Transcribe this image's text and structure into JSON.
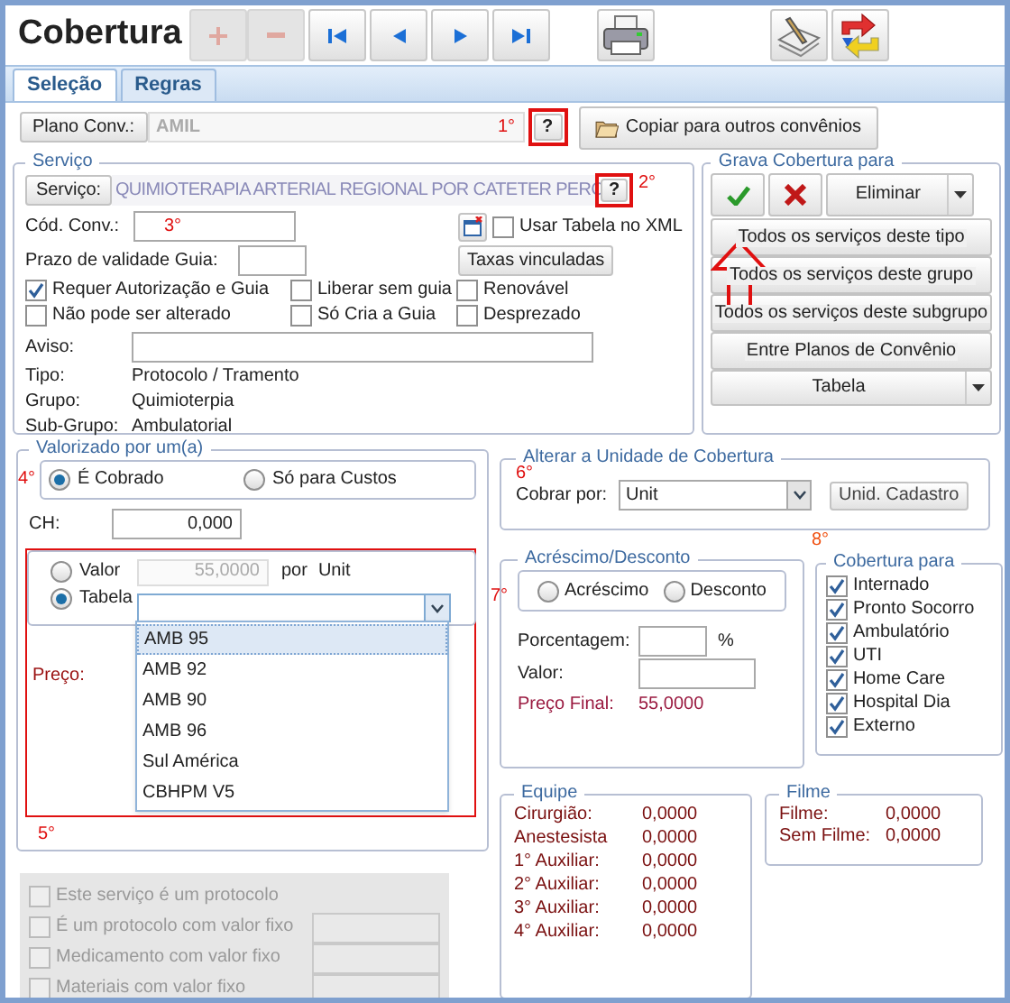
{
  "window": {
    "title": "Cobertura"
  },
  "toolbar": [
    {
      "kind": "add",
      "disabled": true
    },
    {
      "kind": "remove",
      "disabled": true
    },
    {
      "kind": "first",
      "disabled": false
    },
    {
      "kind": "previous",
      "disabled": false
    },
    {
      "kind": "next",
      "disabled": false
    },
    {
      "kind": "last",
      "disabled": false
    },
    {
      "kind": "print",
      "disabled": false
    },
    {
      "kind": "edit",
      "disabled": false
    },
    {
      "kind": "sync",
      "disabled": false
    }
  ],
  "tabs": [
    {
      "label": "Seleção",
      "selected": true
    },
    {
      "label": "Regras",
      "selected": false
    }
  ],
  "plano": {
    "button": "Plano Conv.:",
    "value": "AMIL",
    "annotation": "1°",
    "help": "?",
    "copy_button": "Copiar para outros convênios"
  },
  "servico": {
    "legend": "Serviço",
    "button": "Serviço:",
    "value": "QUIMIOTERAPIA ARTERIAL REGIONAL POR CATETER PERC",
    "help": "?",
    "annotation": "2°",
    "cod_label": "Cód. Conv.:",
    "cod_annotation": "3°",
    "prazo_label": "Prazo de validade Guia:",
    "xml_checkbox": {
      "label": "Usar Tabela no XML",
      "checked": false
    },
    "taxas_button": "Taxas vinculadas",
    "checkboxes": [
      {
        "label": "Requer Autorização e Guia",
        "checked": true
      },
      {
        "label": "Liberar sem guia",
        "checked": false
      },
      {
        "label": "Renovável",
        "checked": false
      },
      {
        "label": "Não pode ser alterado",
        "checked": false
      },
      {
        "label": "Só Cria a Guia",
        "checked": false
      },
      {
        "label": "Desprezado",
        "checked": false
      }
    ],
    "aviso_label": "Aviso:",
    "info": [
      {
        "label": "Tipo:",
        "value": "Protocolo / Tramento"
      },
      {
        "label": "Grupo:",
        "value": "Quimioterpia"
      },
      {
        "label": "Sub-Grupo:",
        "value": "Ambulatorial"
      }
    ]
  },
  "grava": {
    "legend": "Grava Cobertura para",
    "eliminar": "Eliminar",
    "buttons": [
      "Todos os serviços deste tipo",
      "Todos os serviços deste grupo",
      "Todos os serviços deste subgrupo",
      "Entre Planos de Convênio"
    ],
    "tabela": "Tabela"
  },
  "valorizado": {
    "legend": "Valorizado por um(a)",
    "annotation": "4°",
    "radios": [
      {
        "label": "É Cobrado",
        "selected": true
      },
      {
        "label": "Só para Custos",
        "selected": false
      }
    ],
    "ch_label": "CH:",
    "ch_value": "0,000",
    "price_radios": [
      {
        "label": "Valor",
        "selected": false
      },
      {
        "label": "Tabela",
        "selected": true
      }
    ],
    "valor_value": "55,0000",
    "por": "por",
    "unit": "Unit",
    "tabela_select": {
      "expanded": true,
      "options": [
        {
          "label": "AMB 95",
          "selected": true
        },
        {
          "label": "AMB 92",
          "selected": false
        },
        {
          "label": "AMB 90",
          "selected": false
        },
        {
          "label": "AMB 96",
          "selected": false
        },
        {
          "label": "Sul América",
          "selected": false
        },
        {
          "label": "CBHPM V5",
          "selected": false
        }
      ]
    },
    "preco_label": "Preço:",
    "bottom_annotation": "5°"
  },
  "protocolo": [
    {
      "label": "Este serviço é um protocolo",
      "checked": false,
      "kind": "plain"
    },
    {
      "label": "É um protocolo com valor fixo",
      "checked": false,
      "kind": "with_field"
    },
    {
      "label": "Medicamento com valor fixo",
      "checked": false,
      "kind": "with_field"
    },
    {
      "label": "Materiais com valor fixo",
      "checked": false,
      "kind": "with_field"
    }
  ],
  "alterar": {
    "legend": "Alterar a Unidade de Cobertura",
    "annotation": "6°",
    "cobrar_label": "Cobrar por:",
    "cobrar_value": "Unit",
    "unid_button": "Unid. Cadastro"
  },
  "acrescimo": {
    "legend": "Acréscimo/Desconto",
    "annotation": "7°",
    "radios": [
      {
        "label": "Acréscimo",
        "selected": false
      },
      {
        "label": "Desconto",
        "selected": false
      }
    ],
    "porcentagem_label": "Porcentagem:",
    "percent": "%",
    "valor_label": "Valor:",
    "preco_final_label": "Preço Final:",
    "preco_final_value": "55,0000"
  },
  "cobertura_para": {
    "legend": "Cobertura para",
    "annotation": "8°",
    "items": [
      {
        "label": "Internado",
        "checked": true
      },
      {
        "label": "Pronto Socorro",
        "checked": true
      },
      {
        "label": "Ambulatório",
        "checked": true
      },
      {
        "label": "UTI",
        "checked": true
      },
      {
        "label": "Home Care",
        "checked": true
      },
      {
        "label": "Hospital Dia",
        "checked": true
      },
      {
        "label": "Externo",
        "checked": true
      }
    ]
  },
  "equipe": {
    "legend": "Equipe",
    "rows": [
      {
        "label": "Cirurgião:",
        "value": "0,0000"
      },
      {
        "label": "Anestesista",
        "value": "0,0000"
      },
      {
        "label": "1° Auxiliar:",
        "value": "0,0000"
      },
      {
        "label": "2° Auxiliar:",
        "value": "0,0000"
      },
      {
        "label": "3° Auxiliar:",
        "value": "0,0000"
      },
      {
        "label": "4° Auxiliar:",
        "value": "0,0000"
      }
    ]
  },
  "filme": {
    "legend": "Filme",
    "rows": [
      {
        "label": "Filme:",
        "value": "0,0000"
      },
      {
        "label": "Sem Filme:",
        "value": "0,0000"
      }
    ]
  }
}
